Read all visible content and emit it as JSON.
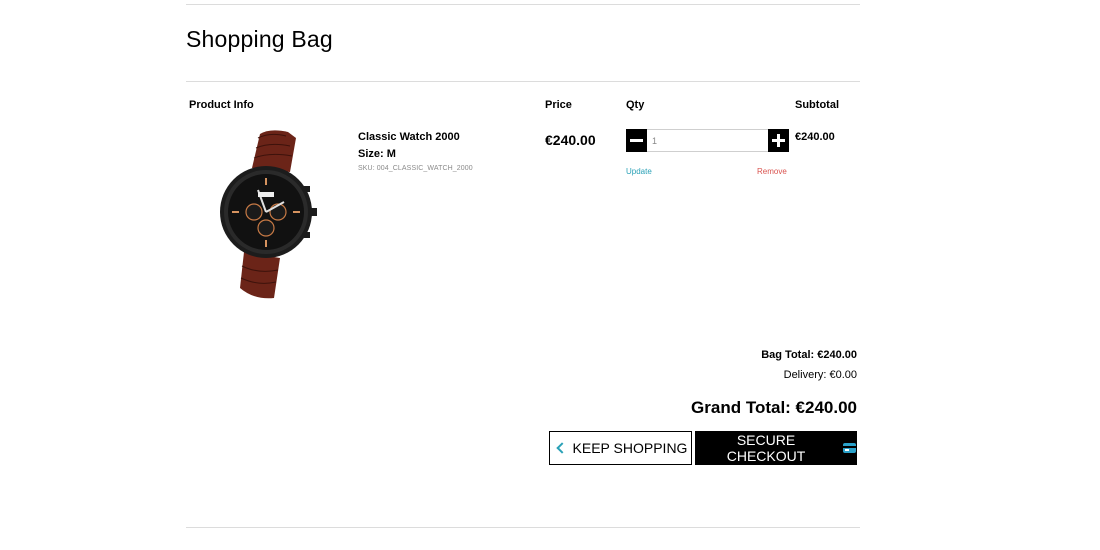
{
  "page": {
    "title": "Shopping Bag"
  },
  "table": {
    "headers": {
      "product_info": "Product Info",
      "price": "Price",
      "qty": "Qty",
      "subtotal": "Subtotal"
    }
  },
  "item": {
    "image_icon": "wristwatch-image",
    "name": "Classic Watch 2000",
    "size": "Size: M",
    "sku": "SKU: 004_CLASSIC_WATCH_2000",
    "price": "€240.00",
    "quantity": "1",
    "update_label": "Update",
    "remove_label": "Remove",
    "subtotal": "€240.00"
  },
  "totals": {
    "bag_total": "Bag Total: €240.00",
    "delivery": "Delivery: €0.00",
    "grand_total": "Grand Total: €240.00"
  },
  "actions": {
    "keep_shopping": "KEEP SHOPPING",
    "keep_shopping_icon": "chevron-left-icon",
    "secure_checkout": "SECURE CHECKOUT",
    "secure_checkout_icon": "credit-card-icon"
  },
  "colors": {
    "accent": "#2aa1b7",
    "remove": "#d9534f",
    "button_dark": "#000000"
  }
}
